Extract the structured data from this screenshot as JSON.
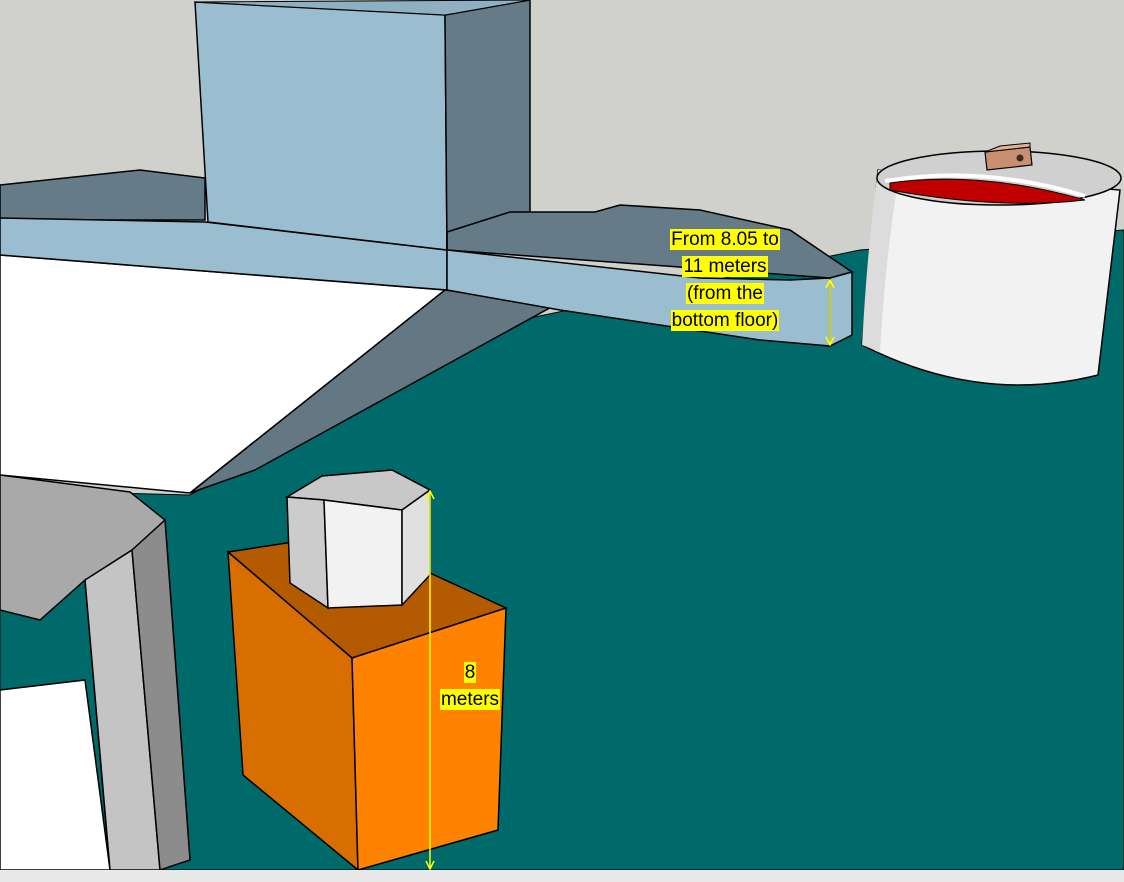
{
  "scene": {
    "annotations": {
      "bridge_height": {
        "lines": [
          "From 8.05 to",
          "11 meters",
          "(from the",
          "bottom floor)"
        ]
      },
      "tower_height": {
        "lines": [
          "8",
          "meters"
        ]
      }
    },
    "colors": {
      "sky": "#d0d0cc",
      "ground": "#006a6a",
      "blue_face": "#9bbdd0",
      "blue_dark": "#657b87",
      "orange_front": "#ff8200",
      "orange_side": "#d96e00",
      "orange_top": "#b45a00",
      "dimension_line": "#ffff00",
      "label_bg": "#ffff00",
      "tank_liquid": "#c00000"
    }
  }
}
